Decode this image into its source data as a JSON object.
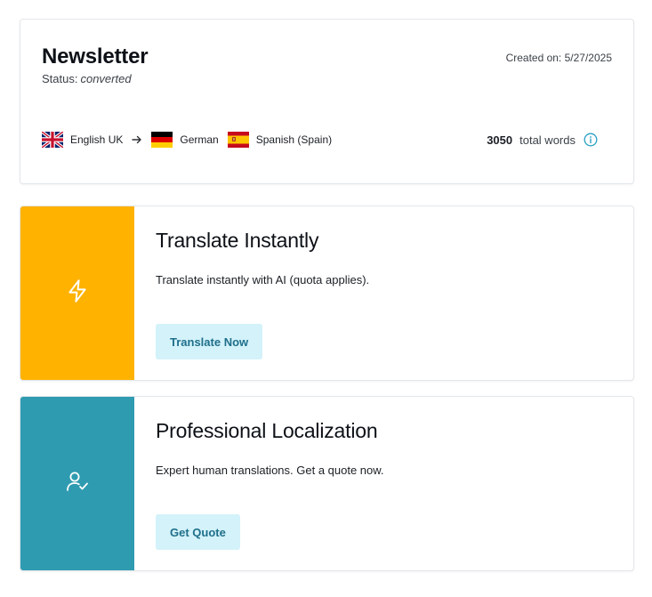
{
  "document": {
    "title": "Newsletter",
    "status_label": "Status:",
    "status_value": "converted",
    "created": "Created on: 5/27/2025",
    "source_language": "English UK",
    "target_languages": [
      "German",
      "Spanish (Spain)"
    ],
    "total_words": "3050",
    "total_words_label": "total words"
  },
  "options": {
    "instant": {
      "title": "Translate Instantly",
      "description": "Translate instantly with AI (quota applies).",
      "button_label": "Translate Now",
      "accent_color": "#ffb200",
      "icon": "lightning-icon"
    },
    "professional": {
      "title": "Professional Localization",
      "description": "Expert human translations. Get a quote now.",
      "button_label": "Get Quote",
      "accent_color": "#2f9bb1",
      "icon": "user-check-icon"
    }
  },
  "colors": {
    "button_bg": "#d3f2fa",
    "button_text": "#1f6f8a",
    "info_icon": "#2a9fc4"
  }
}
